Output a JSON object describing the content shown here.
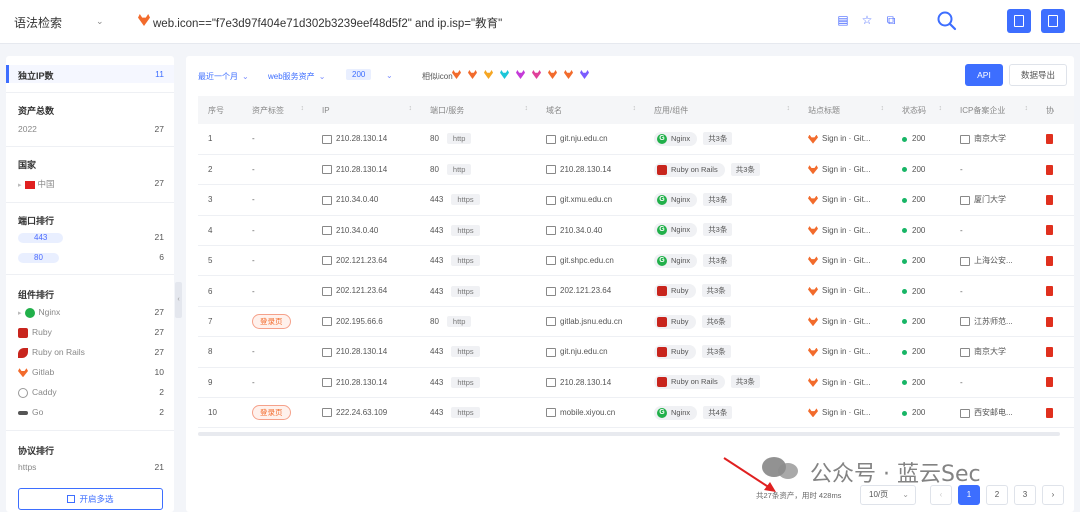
{
  "topbar": {
    "mode_label": "语法检索",
    "query": "web.icon==\"f7e3d97f404e71d302b3239eef48d5f2\" and ip.isp=\"教育\""
  },
  "sidebar": {
    "sections": [
      {
        "title": "独立IP数",
        "count": "11"
      },
      {
        "title": "资产总数",
        "rows": [
          {
            "label": "2022",
            "count": "27"
          }
        ]
      },
      {
        "title": "国家",
        "rows": [
          {
            "label": "中国",
            "count": "27"
          }
        ]
      },
      {
        "title": "端口排行",
        "rows": [
          {
            "label": "443",
            "count": "21"
          },
          {
            "label": "80",
            "count": "6"
          }
        ]
      },
      {
        "title": "组件排行",
        "rows": [
          {
            "label": "Nginx",
            "count": "27"
          },
          {
            "label": "Ruby",
            "count": "27"
          },
          {
            "label": "Ruby on Rails",
            "count": "27"
          },
          {
            "label": "Gitlab",
            "count": "10"
          },
          {
            "label": "Caddy",
            "count": "2"
          },
          {
            "label": "Go",
            "count": "2"
          }
        ]
      },
      {
        "title": "协议排行",
        "rows": [
          {
            "label": "https",
            "count": "21"
          }
        ]
      }
    ],
    "multi_select_label": "开启多选"
  },
  "toolbar": {
    "time_filter": "最近一个月",
    "asset_filter": "web服务资产",
    "status_badge": "200",
    "fav_label": "相似icon",
    "api_label": "API",
    "export_label": "数据导出"
  },
  "fav_colors": [
    "#f26b2c",
    "#f26b2c",
    "#f5a623",
    "#1cc6d8",
    "#c43ad8",
    "#e0409a",
    "#f26b2c",
    "#f26b2c",
    "#7b5cff"
  ],
  "table": {
    "headers": [
      "序号",
      "资产标签",
      "IP",
      "端口/服务",
      "域名",
      "应用/组件",
      "站点标题",
      "状态码",
      "ICP备案企业",
      "协"
    ],
    "rows": [
      {
        "no": "1",
        "label": "-",
        "ip": "210.28.130.14",
        "port": "80",
        "proto": "http",
        "domain": "git.nju.edu.cn",
        "app": "Nginx",
        "app_type": "nginx",
        "more": "共3条",
        "title": "Sign in · Git...",
        "status": "200",
        "icp": "南京大学"
      },
      {
        "no": "2",
        "label": "-",
        "ip": "210.28.130.14",
        "port": "80",
        "proto": "http",
        "domain": "210.28.130.14",
        "app": "Ruby on Rails",
        "app_type": "rails",
        "more": "共3条",
        "title": "Sign in · Git...",
        "status": "200",
        "icp": "-"
      },
      {
        "no": "3",
        "label": "-",
        "ip": "210.34.0.40",
        "port": "443",
        "proto": "https",
        "domain": "git.xmu.edu.cn",
        "app": "Nginx",
        "app_type": "nginx",
        "more": "共3条",
        "title": "Sign in · Git...",
        "status": "200",
        "icp": "厦门大学"
      },
      {
        "no": "4",
        "label": "-",
        "ip": "210.34.0.40",
        "port": "443",
        "proto": "https",
        "domain": "210.34.0.40",
        "app": "Nginx",
        "app_type": "nginx",
        "more": "共3条",
        "title": "Sign in · Git...",
        "status": "200",
        "icp": "-"
      },
      {
        "no": "5",
        "label": "-",
        "ip": "202.121.23.64",
        "port": "443",
        "proto": "https",
        "domain": "git.shpc.edu.cn",
        "app": "Nginx",
        "app_type": "nginx",
        "more": "共3条",
        "title": "Sign in · Git...",
        "status": "200",
        "icp": "上海公安..."
      },
      {
        "no": "6",
        "label": "-",
        "ip": "202.121.23.64",
        "port": "443",
        "proto": "https",
        "domain": "202.121.23.64",
        "app": "Ruby",
        "app_type": "ruby",
        "more": "共3条",
        "title": "Sign in · Git...",
        "status": "200",
        "icp": "-"
      },
      {
        "no": "7",
        "label": "登录页",
        "ip": "202.195.66.6",
        "port": "80",
        "proto": "http",
        "domain": "gitlab.jsnu.edu.cn",
        "app": "Ruby",
        "app_type": "ruby",
        "more": "共6条",
        "title": "Sign in · Git...",
        "status": "200",
        "icp": "江苏师范..."
      },
      {
        "no": "8",
        "label": "-",
        "ip": "210.28.130.14",
        "port": "443",
        "proto": "https",
        "domain": "git.nju.edu.cn",
        "app": "Ruby",
        "app_type": "ruby",
        "more": "共3条",
        "title": "Sign in · Git...",
        "status": "200",
        "icp": "南京大学"
      },
      {
        "no": "9",
        "label": "-",
        "ip": "210.28.130.14",
        "port": "443",
        "proto": "https",
        "domain": "210.28.130.14",
        "app": "Ruby on Rails",
        "app_type": "rails",
        "more": "共3条",
        "title": "Sign in · Git...",
        "status": "200",
        "icp": "-"
      },
      {
        "no": "10",
        "label": "登录页",
        "ip": "222.24.63.109",
        "port": "443",
        "proto": "https",
        "domain": "mobile.xiyou.cn",
        "app": "Nginx",
        "app_type": "nginx",
        "more": "共4条",
        "title": "Sign in · Git...",
        "status": "200",
        "icp": "西安邮电..."
      }
    ]
  },
  "pagination": {
    "total_text": "共27条资产，用时 428ms",
    "per_page": "10/页",
    "pages": [
      "1",
      "2",
      "3"
    ],
    "current": "1"
  },
  "watermark": "公众号 · 蓝云Sec"
}
